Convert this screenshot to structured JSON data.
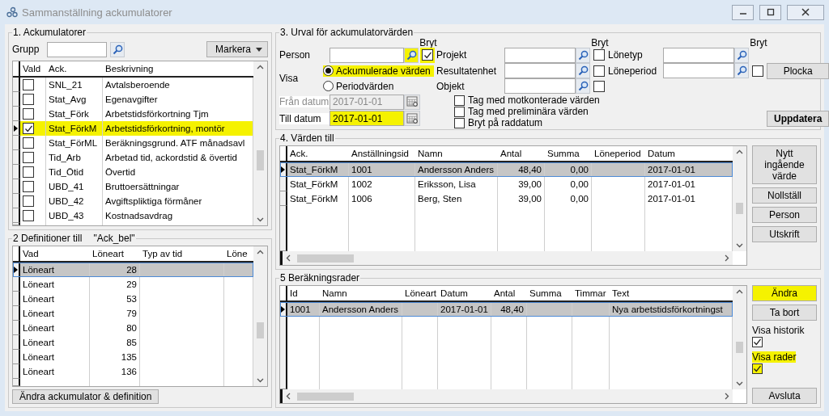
{
  "window": {
    "title": "Sammanställning ackumulatorer"
  },
  "accumulators": {
    "title": "1. Ackumulatorer",
    "group_label": "Grupp",
    "mark_button": "Markera",
    "columns": [
      "Vald",
      "Ack.",
      "Beskrivning"
    ],
    "rows": [
      {
        "checked": false,
        "code": "SNL_21",
        "description": "Avtalsberoende",
        "selected": false,
        "highlighted": false
      },
      {
        "checked": false,
        "code": "Stat_Avg",
        "description": "Egenavgifter",
        "selected": false,
        "highlighted": false
      },
      {
        "checked": false,
        "code": "Stat_Förk",
        "description": "Arbetstidsförkortning Tjm",
        "selected": false,
        "highlighted": false
      },
      {
        "checked": true,
        "code": "Stat_FörkM",
        "description": "Arbetstidsförkortning, montör",
        "selected": true,
        "highlighted": true
      },
      {
        "checked": false,
        "code": "Stat_FörML",
        "description": "Beräkningsgrund. ATF månadsavl",
        "selected": false,
        "highlighted": false
      },
      {
        "checked": false,
        "code": "Tid_Arb",
        "description": "Arbetad tid, ackordstid & övertid",
        "selected": false,
        "highlighted": false
      },
      {
        "checked": false,
        "code": "Tid_Ötid",
        "description": "Övertid",
        "selected": false,
        "highlighted": false
      },
      {
        "checked": false,
        "code": "UBD_41",
        "description": "Bruttoersättningar",
        "selected": false,
        "highlighted": false
      },
      {
        "checked": false,
        "code": "UBD_42",
        "description": "Avgiftspliktiga förmåner",
        "selected": false,
        "highlighted": false
      },
      {
        "checked": false,
        "code": "UBD_43",
        "description": "Kostnadsavdrag",
        "selected": false,
        "highlighted": false
      }
    ]
  },
  "definitions": {
    "title": "2 Definitioner till",
    "subject": "\"Ack_bel\"",
    "columns": [
      "Vad",
      "Löneart",
      "Typ av tid",
      "Löne"
    ],
    "rows": [
      {
        "type": "Löneart",
        "wage_type": "28",
        "selected": true
      },
      {
        "type": "Löneart",
        "wage_type": "29",
        "selected": false
      },
      {
        "type": "Löneart",
        "wage_type": "53",
        "selected": false
      },
      {
        "type": "Löneart",
        "wage_type": "79",
        "selected": false
      },
      {
        "type": "Löneart",
        "wage_type": "80",
        "selected": false
      },
      {
        "type": "Löneart",
        "wage_type": "85",
        "selected": false
      },
      {
        "type": "Löneart",
        "wage_type": "135",
        "selected": false
      },
      {
        "type": "Löneart",
        "wage_type": "136",
        "selected": false
      }
    ],
    "button": "Ändra ackumulator & definition"
  },
  "selection": {
    "title": "3. Urval för ackumulatorvärden",
    "break_headers": [
      "Bryt",
      "Bryt",
      "Bryt"
    ],
    "fields": [
      {
        "label": "Person",
        "break_checked": true,
        "highlighted": true
      },
      {
        "label": "Projekt",
        "break_checked": false,
        "highlighted": false
      },
      {
        "label": "Resultatenhet",
        "break_checked": false,
        "highlighted": false
      },
      {
        "label": "Objekt",
        "break_checked": false,
        "highlighted": false
      },
      {
        "label": "Lönetyp",
        "highlighted": false
      },
      {
        "label": "Löneperiod",
        "break_checked": false,
        "highlighted": false
      }
    ],
    "show_label": "Visa",
    "show_options": [
      {
        "label": "Ackumulerade värden",
        "selected": true,
        "highlighted": true
      },
      {
        "label": "Periodvärden",
        "selected": false,
        "highlighted": false
      }
    ],
    "from_date": {
      "label": "Från datum",
      "value": "2017-01-01",
      "disabled": true,
      "highlighted": false
    },
    "to_date": {
      "label": "Till datum",
      "value": "2017-01-01",
      "disabled": false,
      "highlighted": true
    },
    "options": [
      {
        "label": "Tag med motkonterade värden",
        "checked": false
      },
      {
        "label": "Tag med preliminära värden",
        "checked": false
      },
      {
        "label": "Bryt på raddatum",
        "checked": false
      }
    ],
    "pick_button": "Plocka",
    "update_button": "Uppdatera"
  },
  "values": {
    "title": "4. Värden till",
    "columns": [
      "Ack.",
      "Anställningsid",
      "Namn",
      "Antal",
      "Summa",
      "Löneperiod",
      "Datum"
    ],
    "rows": [
      {
        "accumulator": "Stat_FörkM",
        "employment_id": "1001",
        "name": "Andersson Anders",
        "quantity": "48,40",
        "amount": "0,00",
        "date": "2017-01-01",
        "selected": true
      },
      {
        "accumulator": "Stat_FörkM",
        "employment_id": "1002",
        "name": "Eriksson, Lisa",
        "quantity": "39,00",
        "amount": "0,00",
        "date": "2017-01-01",
        "selected": false
      },
      {
        "accumulator": "Stat_FörkM",
        "employment_id": "1006",
        "name": "Berg, Sten",
        "quantity": "39,00",
        "amount": "0,00",
        "date": "2017-01-01",
        "selected": false
      }
    ],
    "buttons": [
      "Nytt ingående värde",
      "Nollställ",
      "Person",
      "Utskrift"
    ]
  },
  "calc_rows": {
    "title": "5 Beräkningsrader",
    "columns": [
      "Id",
      "Namn",
      "Löneart",
      "Datum",
      "Antal",
      "Summa",
      "Timmar",
      "Text"
    ],
    "rows": [
      {
        "id": "1001",
        "name": "Andersson Anders",
        "date": "2017-01-01",
        "quantity": "48,40",
        "text": "Nya arbetstidsförkortningst",
        "selected": true
      }
    ],
    "buttons": [
      {
        "label": "Ändra",
        "highlighted": true
      },
      {
        "label": "Ta bort",
        "highlighted": false
      }
    ],
    "toggles": [
      {
        "label": "Visa historik",
        "checked": true,
        "highlighted": false
      },
      {
        "label": "Visa rader",
        "checked": true,
        "highlighted": true
      }
    ],
    "close_button": "Avsluta"
  }
}
